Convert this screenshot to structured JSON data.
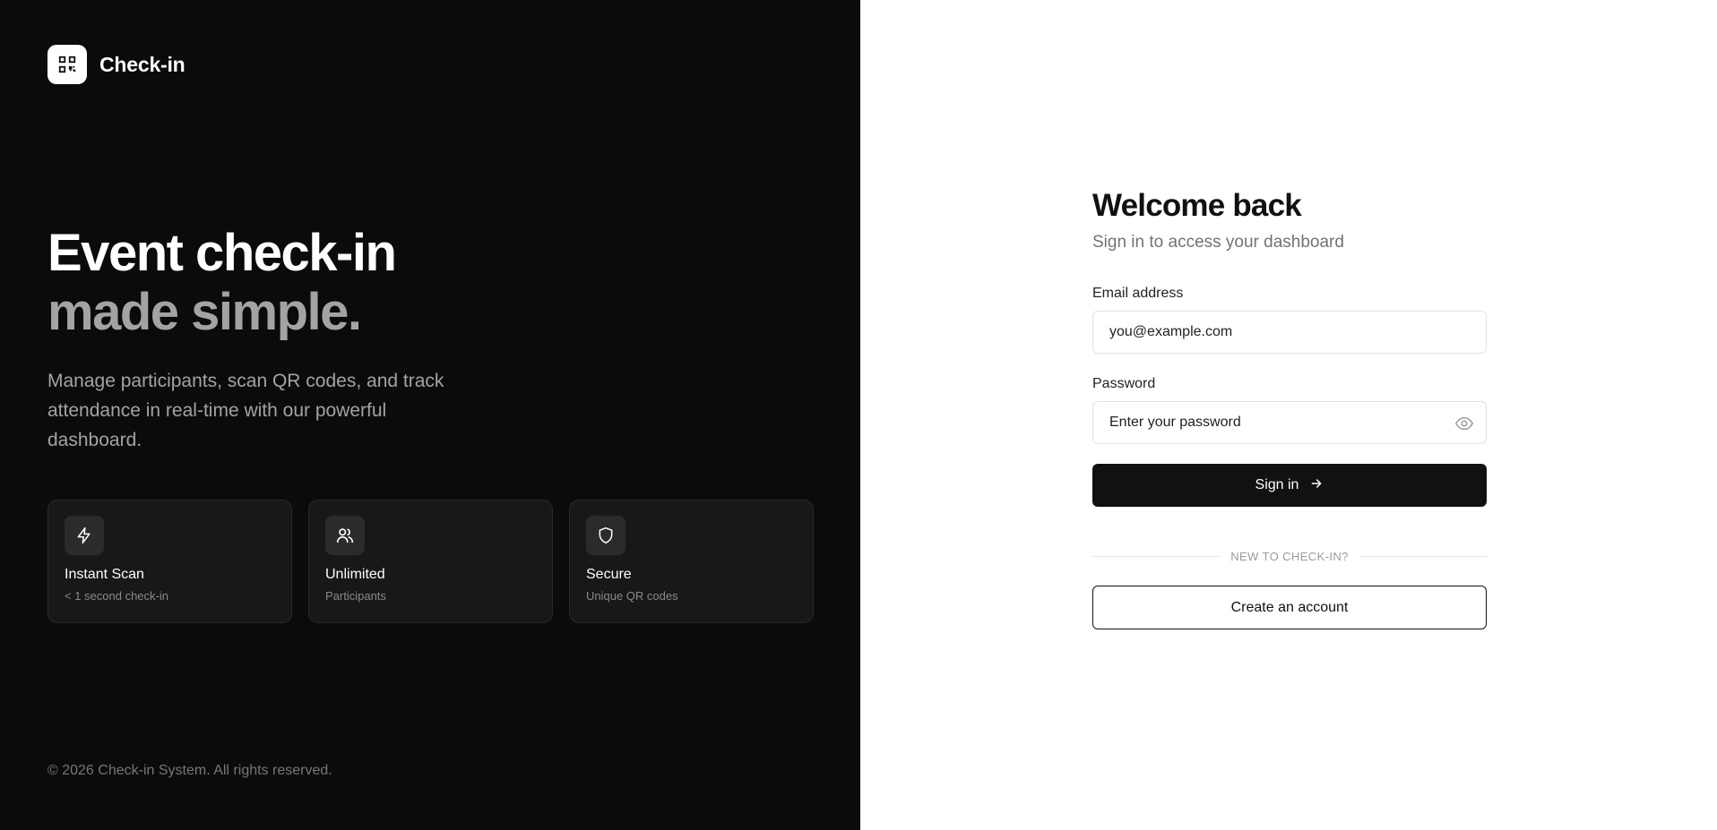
{
  "brand": {
    "name": "Check-in",
    "logo_icon": "qr-code-icon"
  },
  "hero": {
    "line1": "Event check-in",
    "line2": "made simple.",
    "description": "Manage participants, scan QR codes, and track attendance in real-time with our powerful dashboard."
  },
  "features": [
    {
      "icon": "lightning-icon",
      "title": "Instant Scan",
      "subtitle": "< 1 second check-in"
    },
    {
      "icon": "users-icon",
      "title": "Unlimited",
      "subtitle": "Participants"
    },
    {
      "icon": "shield-icon",
      "title": "Secure",
      "subtitle": "Unique QR codes"
    }
  ],
  "footer": {
    "copyright": "© 2026 Check-in System. All rights reserved."
  },
  "login": {
    "title": "Welcome back",
    "subtitle": "Sign in to access your dashboard",
    "email_label": "Email address",
    "email_placeholder": "you@example.com",
    "password_label": "Password",
    "password_placeholder": "Enter your password",
    "signin_label": "Sign in",
    "divider_text": "NEW TO CHECK-IN?",
    "create_label": "Create an account"
  },
  "colors": {
    "left_bg": "#0b0b0b",
    "accent": "#111111",
    "muted": "#a3a3a3"
  }
}
